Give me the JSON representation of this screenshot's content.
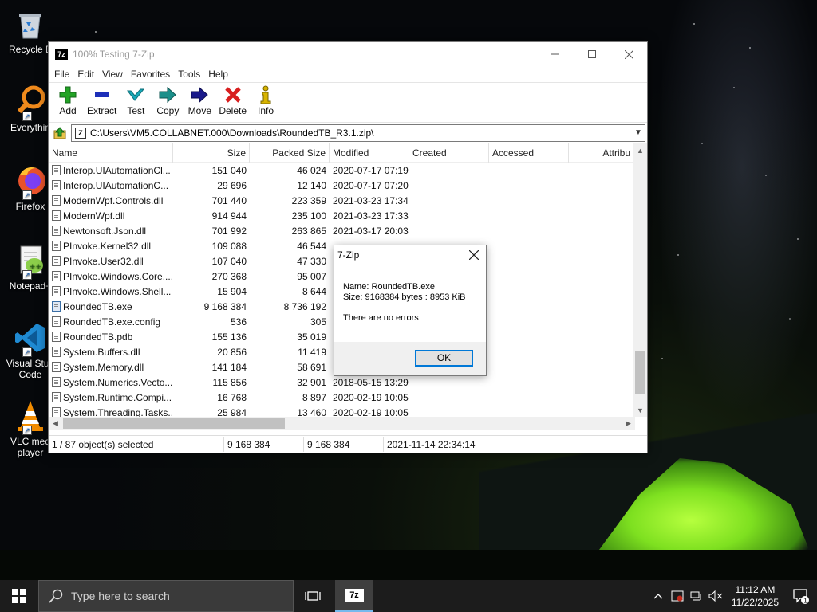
{
  "desktop": {
    "icons": [
      {
        "label": "Recycle Bin",
        "display": "Recycle B"
      },
      {
        "label": "Everything",
        "display": "Everythin"
      },
      {
        "label": "Firefox",
        "display": "Firefox"
      },
      {
        "label": "Notepad++",
        "display": "Notepad+"
      },
      {
        "label": "Visual Studio Code",
        "display": "Visual Stud Code"
      },
      {
        "label": "VLC media player",
        "display": "VLC med player"
      }
    ]
  },
  "window": {
    "title": "100% Testing 7-Zip",
    "icon_text": "7z",
    "menu": [
      "File",
      "Edit",
      "View",
      "Favorites",
      "Tools",
      "Help"
    ],
    "toolbar": [
      {
        "label": "Add",
        "icon": "plus-icon",
        "color": "#22a325"
      },
      {
        "label": "Extract",
        "icon": "minus-icon",
        "color": "#1d2fb8"
      },
      {
        "label": "Test",
        "icon": "check-icon",
        "color": "#19a9b8"
      },
      {
        "label": "Copy",
        "icon": "copy-arrow-icon",
        "color": "#1b8f8a"
      },
      {
        "label": "Move",
        "icon": "move-arrow-icon",
        "color": "#1a1a8a"
      },
      {
        "label": "Delete",
        "icon": "delete-x-icon",
        "color": "#d81f1f"
      },
      {
        "label": "Info",
        "icon": "info-icon",
        "color": "#d8b400"
      }
    ],
    "address": "C:\\Users\\VM5.COLLABNET.000\\Downloads\\RoundedTB_R3.1.zip\\",
    "columns": [
      "Name",
      "Size",
      "Packed Size",
      "Modified",
      "Created",
      "Accessed",
      "Attribu"
    ],
    "rows": [
      {
        "name": "Interop.UIAutomationCl...",
        "size": "151 040",
        "packed": "46 024",
        "modified": "2020-07-17 07:19",
        "type": "file"
      },
      {
        "name": "Interop.UIAutomationC...",
        "size": "29 696",
        "packed": "12 140",
        "modified": "2020-07-17 07:20",
        "type": "file"
      },
      {
        "name": "ModernWpf.Controls.dll",
        "size": "701 440",
        "packed": "223 359",
        "modified": "2021-03-23 17:34",
        "type": "file"
      },
      {
        "name": "ModernWpf.dll",
        "size": "914 944",
        "packed": "235 100",
        "modified": "2021-03-23 17:33",
        "type": "file"
      },
      {
        "name": "Newtonsoft.Json.dll",
        "size": "701 992",
        "packed": "263 865",
        "modified": "2021-03-17 20:03",
        "type": "file"
      },
      {
        "name": "PInvoke.Kernel32.dll",
        "size": "109 088",
        "packed": "46 544",
        "modified": "",
        "type": "file"
      },
      {
        "name": "PInvoke.User32.dll",
        "size": "107 040",
        "packed": "47 330",
        "modified": "",
        "type": "file"
      },
      {
        "name": "PInvoke.Windows.Core....",
        "size": "270 368",
        "packed": "95 007",
        "modified": "",
        "type": "file"
      },
      {
        "name": "PInvoke.Windows.Shell...",
        "size": "15 904",
        "packed": "8 644",
        "modified": "",
        "type": "file"
      },
      {
        "name": "RoundedTB.exe",
        "size": "9 168 384",
        "packed": "8 736 192",
        "modified": "",
        "type": "exe"
      },
      {
        "name": "RoundedTB.exe.config",
        "size": "536",
        "packed": "305",
        "modified": "",
        "type": "file"
      },
      {
        "name": "RoundedTB.pdb",
        "size": "155 136",
        "packed": "35 019",
        "modified": "",
        "type": "file"
      },
      {
        "name": "System.Buffers.dll",
        "size": "20 856",
        "packed": "11 419",
        "modified": "",
        "type": "file"
      },
      {
        "name": "System.Memory.dll",
        "size": "141 184",
        "packed": "58 691",
        "modified": "",
        "type": "file"
      },
      {
        "name": "System.Numerics.Vecto...",
        "size": "115 856",
        "packed": "32 901",
        "modified": "2018-05-15 13:29",
        "type": "file"
      },
      {
        "name": "System.Runtime.Compi...",
        "size": "16 768",
        "packed": "8 897",
        "modified": "2020-02-19 10:05",
        "type": "file"
      },
      {
        "name": "System.Threading.Tasks....",
        "size": "25 984",
        "packed": "13 460",
        "modified": "2020-02-19 10:05",
        "type": "file"
      }
    ],
    "status": {
      "selection": "1 / 87 object(s) selected",
      "size": "9 168 384",
      "packed": "9 168 384",
      "modified": "2021-11-14 22:34:14"
    }
  },
  "dialog": {
    "title": "7-Zip",
    "name_line": "Name: RoundedTB.exe",
    "size_line": "Size: 9168384 bytes : 8953 KiB",
    "message": "There are no errors",
    "ok_label": "OK"
  },
  "taskbar": {
    "search_placeholder": "Type here to search",
    "app_label": "7z",
    "time": "11:12 AM",
    "date": "11/22/2025",
    "notification_count": "1"
  }
}
